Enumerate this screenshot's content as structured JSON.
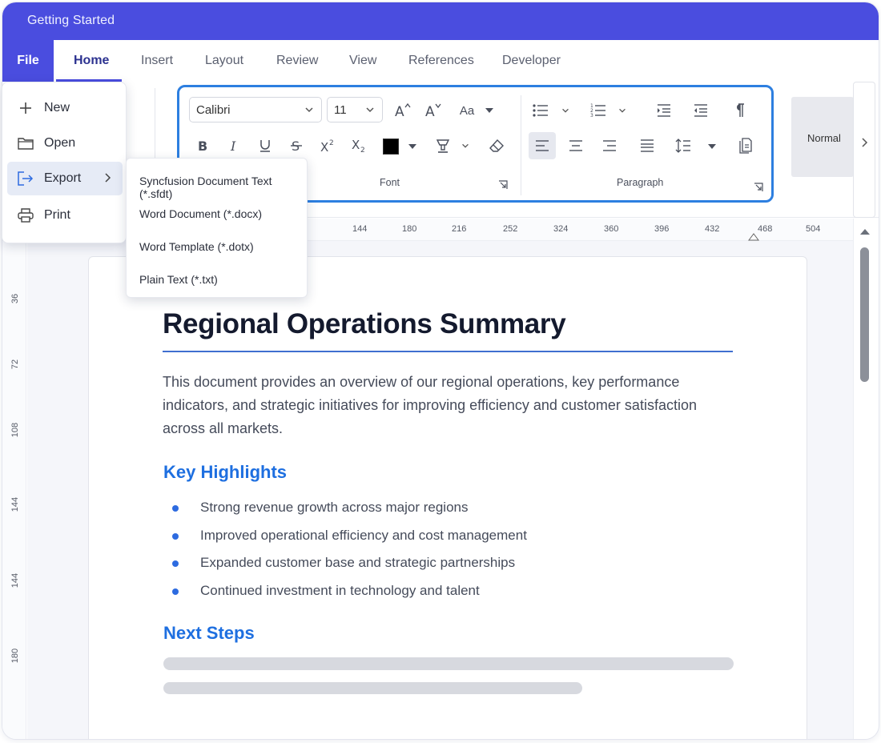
{
  "window": {
    "title": "Getting Started",
    "accent": "#4a4ddf"
  },
  "tabs": [
    {
      "label": "File"
    },
    {
      "label": "Home"
    },
    {
      "label": "Insert"
    },
    {
      "label": "Layout"
    },
    {
      "label": "Review"
    },
    {
      "label": "View"
    },
    {
      "label": "References"
    },
    {
      "label": "Developer"
    }
  ],
  "ribbon": {
    "font_name": "Calibri",
    "font_size": "11",
    "change_case_label": "Aa",
    "font_color": "#000000",
    "font_group_label": "Font",
    "paragraph_group_label": "Paragraph",
    "style_normal": "Normal"
  },
  "file_menu": {
    "items": [
      {
        "label": "New",
        "icon": "plus-icon"
      },
      {
        "label": "Open",
        "icon": "folder-icon"
      },
      {
        "label": "Export",
        "icon": "export-icon"
      },
      {
        "label": "Print",
        "icon": "printer-icon"
      }
    ],
    "export_submenu": [
      "Syncfusion Document Text (*.sfdt)",
      "Word Document (*.docx)",
      "Word Template (*.dotx)",
      "Plain Text (*.txt)"
    ]
  },
  "ruler": {
    "horizontal": [
      "144",
      "180",
      "216",
      "252",
      "324",
      "360",
      "396",
      "432",
      "468",
      "504"
    ],
    "vertical": [
      "36",
      "72",
      "108",
      "144",
      "144",
      "180"
    ]
  },
  "document": {
    "title": "Regional Operations Summary",
    "intro": "This document provides an overview of our regional operations, key performance indicators, and strategic initiatives for improving efficiency and customer satisfaction across all markets.",
    "highlights_heading": "Key Highlights",
    "highlights": [
      "Strong revenue growth across major regions",
      "Improved operational efficiency and cost management",
      "Expanded customer base and strategic partnerships",
      "Continued investment in technology and talent"
    ],
    "next_steps_heading": "Next Steps"
  }
}
